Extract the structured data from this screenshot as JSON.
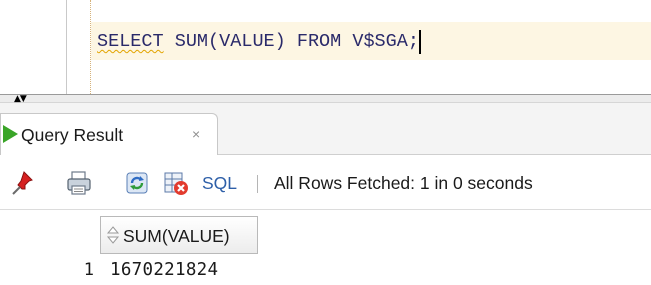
{
  "editor": {
    "sql_kw_select": "SELECT",
    "sql_rest": " SUM(VALUE) FROM V$SGA;"
  },
  "result_tab": {
    "label": "Query Result",
    "close": "×",
    "icon": "run-triangle-icon"
  },
  "toolbar": {
    "icons": [
      "pin-icon",
      "print-icon",
      "refresh-icon",
      "clear-icon"
    ],
    "sql_label": "SQL",
    "status": "All Rows Fetched: 1 in 0 seconds"
  },
  "grid": {
    "columns": [
      "SUM(VALUE)"
    ],
    "rows": [
      {
        "num": "1",
        "values": [
          "1670221824"
        ]
      }
    ]
  },
  "colors": {
    "sql_text": "#2a2a6a",
    "run_green": "#3aa528",
    "link_blue": "#2e5fa8",
    "pin_red": "#d62020"
  }
}
